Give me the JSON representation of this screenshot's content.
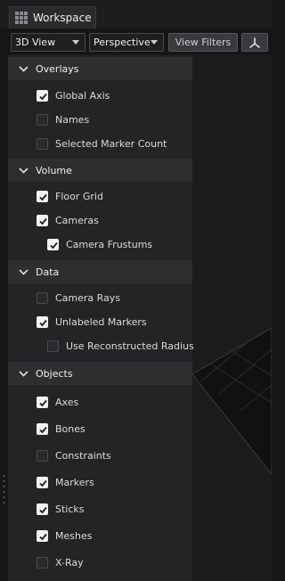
{
  "tab": {
    "label": "Workspace"
  },
  "toolbar": {
    "view_mode": "3D View",
    "projection": "Perspective",
    "view_filters_label": "View Filters"
  },
  "sections": [
    {
      "title": "Overlays",
      "items": [
        {
          "label": "Global Axis",
          "checked": true
        },
        {
          "label": "Names",
          "checked": false
        },
        {
          "label": "Selected Marker Count",
          "checked": false
        }
      ]
    },
    {
      "title": "Volume",
      "items": [
        {
          "label": "Floor Grid",
          "checked": true
        },
        {
          "label": "Cameras",
          "checked": true
        },
        {
          "label": "Camera Frustums",
          "checked": true
        }
      ]
    },
    {
      "title": "Data",
      "items": [
        {
          "label": "Camera Rays",
          "checked": false
        },
        {
          "label": "Unlabeled Markers",
          "checked": true
        },
        {
          "label": "Use Reconstructed Radius",
          "checked": false
        }
      ]
    },
    {
      "title": "Objects",
      "items": [
        {
          "label": "Axes",
          "checked": true
        },
        {
          "label": "Bones",
          "checked": true
        },
        {
          "label": "Constraints",
          "checked": false
        },
        {
          "label": "Markers",
          "checked": true
        },
        {
          "label": "Sticks",
          "checked": true
        },
        {
          "label": "Meshes",
          "checked": true
        },
        {
          "label": "X-Ray",
          "checked": false
        }
      ]
    }
  ]
}
